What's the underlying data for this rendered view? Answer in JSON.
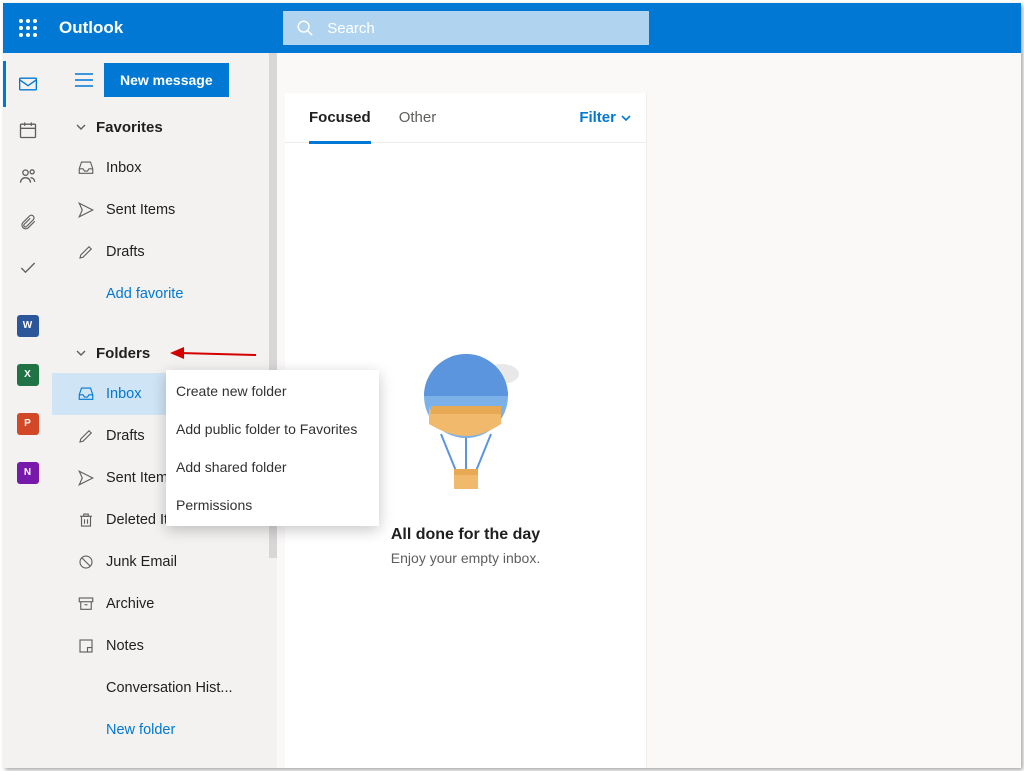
{
  "header": {
    "brand": "Outlook",
    "search_placeholder": "Search"
  },
  "rail": {
    "apps": [
      {
        "name": "word",
        "letter": "W",
        "color": "#2b579a"
      },
      {
        "name": "excel",
        "letter": "X",
        "color": "#217346"
      },
      {
        "name": "powerpoint",
        "letter": "P",
        "color": "#d24726"
      },
      {
        "name": "onenote",
        "letter": "N",
        "color": "#7719aa"
      }
    ]
  },
  "sidebar": {
    "new_message": "New message",
    "favorites_label": "Favorites",
    "favorites": [
      {
        "key": "inbox",
        "label": "Inbox"
      },
      {
        "key": "sent",
        "label": "Sent Items"
      },
      {
        "key": "drafts",
        "label": "Drafts"
      }
    ],
    "add_favorite": "Add favorite",
    "folders_label": "Folders",
    "folders": [
      {
        "key": "inbox",
        "label": "Inbox",
        "selected": true
      },
      {
        "key": "drafts",
        "label": "Drafts"
      },
      {
        "key": "sent",
        "label": "Sent Items"
      },
      {
        "key": "deleted",
        "label": "Deleted Items"
      },
      {
        "key": "junk",
        "label": "Junk Email"
      },
      {
        "key": "archive",
        "label": "Archive"
      },
      {
        "key": "notes",
        "label": "Notes"
      },
      {
        "key": "conversation",
        "label": "Conversation Hist..."
      }
    ],
    "new_folder": "New folder"
  },
  "context_menu": {
    "items": [
      "Create new folder",
      "Add public folder to Favorites",
      "Add shared folder",
      "Permissions"
    ]
  },
  "list": {
    "tab_focused": "Focused",
    "tab_other": "Other",
    "filter": "Filter",
    "empty_title": "All done for the day",
    "empty_sub": "Enjoy your empty inbox."
  }
}
